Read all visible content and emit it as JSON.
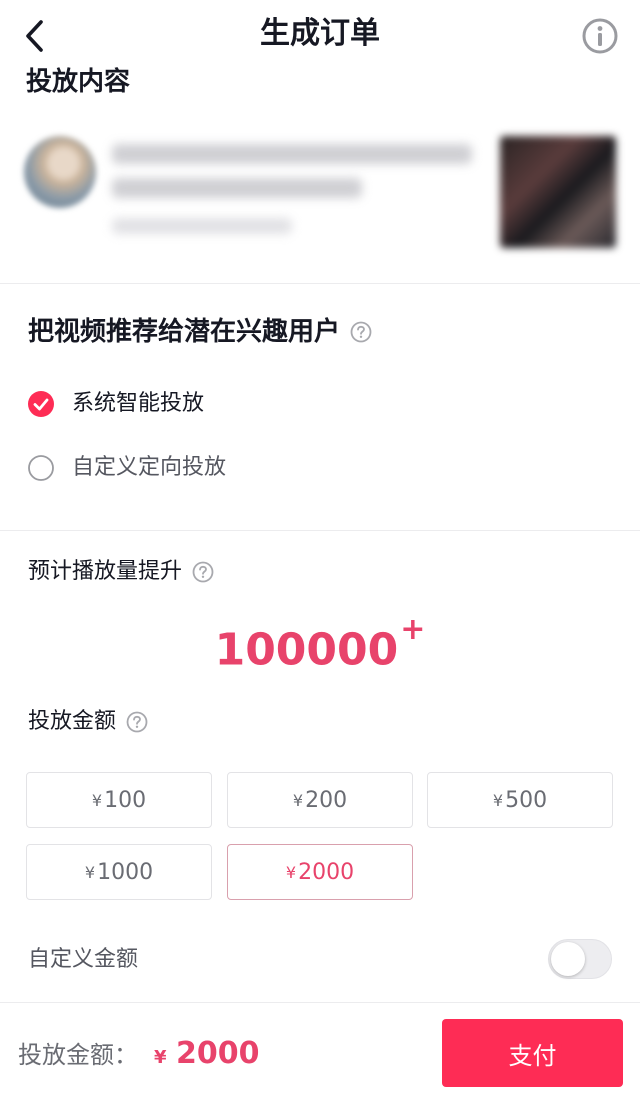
{
  "header": {
    "title": "生成订单",
    "back_icon": "chevron-left-icon",
    "info_icon": "info-icon"
  },
  "content_section": {
    "title": "投放内容"
  },
  "target_section": {
    "title": "把视频推荐给潜在兴趣用户",
    "options": [
      {
        "label": "系统智能投放",
        "selected": true
      },
      {
        "label": "自定义定向投放",
        "selected": false
      }
    ]
  },
  "metric": {
    "label": "预计播放量提升",
    "value": "100000",
    "suffix": "+"
  },
  "amount_section": {
    "label": "投放金额",
    "currency": "¥",
    "options": [
      "100",
      "200",
      "500",
      "1000",
      "2000"
    ],
    "selected": "2000"
  },
  "custom_amount": {
    "label": "自定义金额",
    "enabled": false
  },
  "footer": {
    "label": "投放金额：",
    "currency": "¥",
    "amount": "2000",
    "pay_label": "支付"
  },
  "colors": {
    "accent": "#fe2c55",
    "accent_text": "#e8436b",
    "text_primary": "#161823",
    "border": "#e3e3e6"
  }
}
